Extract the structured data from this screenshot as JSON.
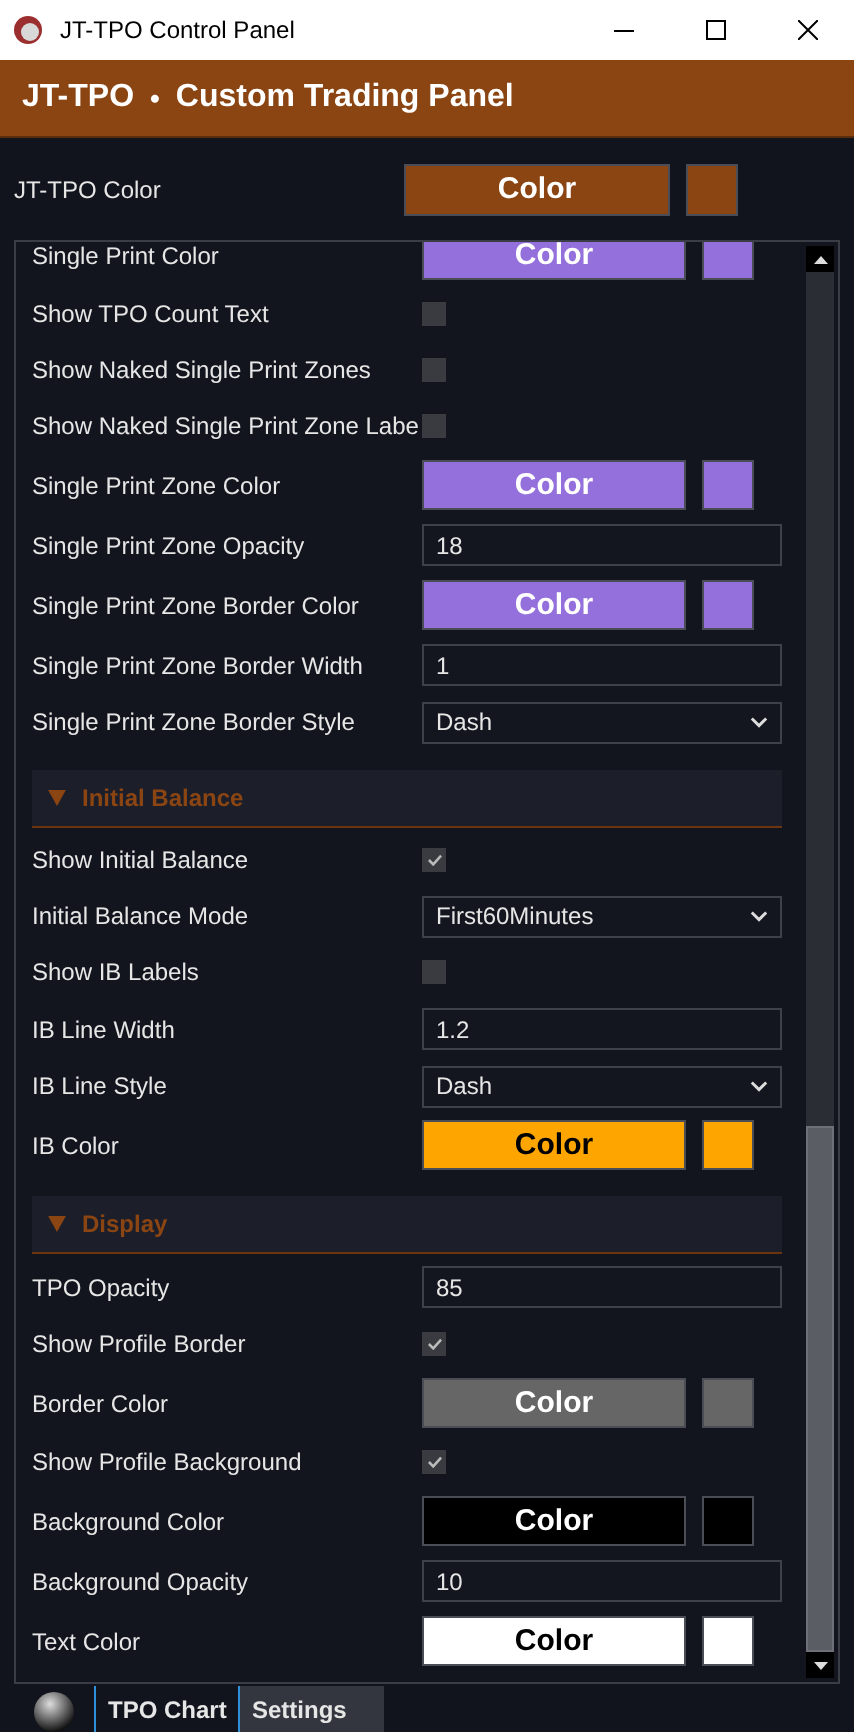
{
  "window": {
    "title": "JT-TPO Control Panel"
  },
  "header": {
    "brand": "JT-TPO",
    "separator": "•",
    "subtitle": "Custom Trading Panel"
  },
  "top_setting": {
    "label": "JT-TPO Color",
    "button": "Color",
    "color": "#8b4513"
  },
  "settings": [
    {
      "kind": "color",
      "label": "Single Print Color",
      "button": "Color",
      "color": "#9370db"
    },
    {
      "kind": "checkbox",
      "label": "Show TPO Count Text",
      "checked": false
    },
    {
      "kind": "checkbox",
      "label": "Show Naked Single Print Zones",
      "checked": false
    },
    {
      "kind": "checkbox",
      "label": "Show Naked Single Print Zone Labe",
      "checked": false
    },
    {
      "kind": "color",
      "label": "Single Print Zone Color",
      "button": "Color",
      "color": "#9370db"
    },
    {
      "kind": "number",
      "label": "Single Print Zone Opacity",
      "value": "18"
    },
    {
      "kind": "color",
      "label": "Single Print Zone Border Color",
      "button": "Color",
      "color": "#9370db"
    },
    {
      "kind": "number",
      "label": "Single Print Zone Border Width",
      "value": "1"
    },
    {
      "kind": "select",
      "label": "Single Print Zone Border Style",
      "value": "Dash"
    },
    {
      "kind": "section",
      "label": "Initial Balance",
      "expanded": true
    },
    {
      "kind": "checkbox",
      "label": "Show Initial Balance",
      "checked": true
    },
    {
      "kind": "select",
      "label": "Initial Balance Mode",
      "value": "First60Minutes"
    },
    {
      "kind": "checkbox",
      "label": "Show IB Labels",
      "checked": false
    },
    {
      "kind": "number",
      "label": "IB Line Width",
      "value": "1.2"
    },
    {
      "kind": "select",
      "label": "IB Line Style",
      "value": "Dash"
    },
    {
      "kind": "color",
      "label": "IB Color",
      "button": "Color",
      "color": "#ffa500"
    },
    {
      "kind": "section",
      "label": "Display",
      "expanded": true
    },
    {
      "kind": "number",
      "label": "TPO Opacity",
      "value": "85"
    },
    {
      "kind": "checkbox",
      "label": "Show Profile Border",
      "checked": true
    },
    {
      "kind": "color",
      "label": "Border Color",
      "button": "Color",
      "color": "#666666"
    },
    {
      "kind": "checkbox",
      "label": "Show Profile Background",
      "checked": true
    },
    {
      "kind": "color",
      "label": "Background Color",
      "button": "Color",
      "color": "#000000"
    },
    {
      "kind": "number",
      "label": "Background Opacity",
      "value": "10"
    },
    {
      "kind": "color",
      "label": "Text Color",
      "button": "Color",
      "color": "#ffffff"
    }
  ],
  "bottom_tabs": [
    {
      "label": "TPO Chart",
      "selected": false
    },
    {
      "label": "Settings",
      "selected": true
    }
  ]
}
